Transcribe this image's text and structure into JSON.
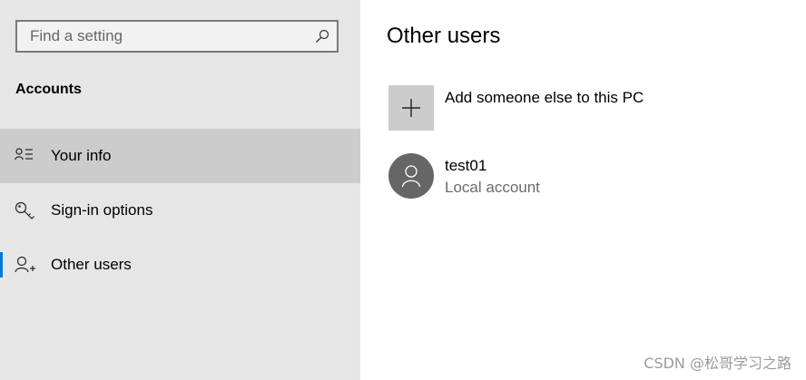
{
  "search": {
    "placeholder": "Find a setting",
    "value": "",
    "icon": "search-icon"
  },
  "sidebar": {
    "heading": "Accounts",
    "items": [
      {
        "label": "Your info",
        "icon": "person-list-icon",
        "state": "hover"
      },
      {
        "label": "Sign-in options",
        "icon": "key-icon",
        "state": "normal"
      },
      {
        "label": "Other users",
        "icon": "person-add-icon",
        "state": "active"
      }
    ]
  },
  "main": {
    "title": "Other users",
    "add_user": {
      "label": "Add someone else to this PC",
      "icon": "plus-icon"
    },
    "users": [
      {
        "name": "test01",
        "type": "Local account",
        "icon": "person-icon"
      }
    ]
  },
  "watermark": "CSDN @松哥学习之路",
  "colors": {
    "sidebar_bg": "#e6e6e6",
    "hover_bg": "#cccccc",
    "accent": "#0078d7",
    "avatar_bg": "#666666",
    "secondary_text": "#6b6b6b"
  }
}
